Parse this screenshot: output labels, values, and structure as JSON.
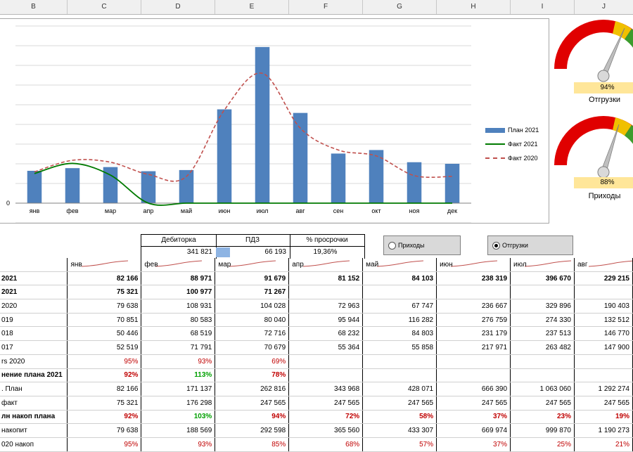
{
  "column_headers": [
    "B",
    "C",
    "D",
    "E",
    "F",
    "G",
    "H",
    "I",
    "J"
  ],
  "chart_data": {
    "type": "bar",
    "categories": [
      "янв",
      "фев",
      "мар",
      "апр",
      "май",
      "июн",
      "июл",
      "авг",
      "сен",
      "окт",
      "ноя",
      "дек"
    ],
    "y_tick_labels": [
      "",
      "",
      "",
      "",
      "",
      "",
      "",
      "",
      "",
      "0",
      ""
    ],
    "series": [
      {
        "name": "План 2021",
        "type": "bar",
        "color": "#4f81bd",
        "values": [
          82166,
          88971,
          91679,
          81152,
          84103,
          238319,
          396670,
          229215,
          126000,
          135000,
          104000,
          100000
        ]
      },
      {
        "name": "Факт 2021",
        "type": "line",
        "color": "#007a00",
        "values": [
          75321,
          100977,
          71267,
          0,
          0,
          0,
          0,
          0,
          0,
          0,
          0,
          0
        ]
      },
      {
        "name": "Факт 2020",
        "type": "line-dashed",
        "color": "#c0504d",
        "values": [
          79638,
          108931,
          104028,
          72963,
          67747,
          236667,
          329896,
          190403,
          135000,
          120000,
          70000,
          68000
        ]
      }
    ],
    "ylim": [
      -50000,
      450000
    ]
  },
  "gauges": [
    {
      "pct": "94%",
      "label": "Отгрузки",
      "value": 0.94
    },
    {
      "pct": "88%",
      "label": "Приходы",
      "value": 0.88
    }
  ],
  "stats": {
    "debitorka_label": "Дебиторка",
    "debitorka_value": "341 821",
    "pdz_label": "ПДЗ",
    "pdz_value": "66 193",
    "overdue_label": "% просрочки",
    "overdue_value": "19,36%"
  },
  "radios": {
    "incoming": "Приходы",
    "shipments": "Отгрузки"
  },
  "table": {
    "months": [
      "янв",
      "фев",
      "мар",
      "апр",
      "май",
      "июн",
      "июл",
      "авг"
    ],
    "rows": [
      {
        "label": "2021",
        "bold": true,
        "cells": [
          "82 166",
          "88 971",
          "91 679",
          "81 152",
          "84 103",
          "238 319",
          "396 670",
          "229 215"
        ]
      },
      {
        "label": "2021",
        "bold": true,
        "cells": [
          "75 321",
          "100 977",
          "71 267",
          "",
          "",
          "",
          "",
          ""
        ]
      },
      {
        "label": "2020",
        "cells": [
          "79 638",
          "108 931",
          "104 028",
          "72 963",
          "67 747",
          "236 667",
          "329 896",
          "190 403"
        ]
      },
      {
        "label": "019",
        "cells": [
          "70 851",
          "80 583",
          "80 040",
          "95 944",
          "116 282",
          "276 759",
          "274 330",
          "132 512"
        ]
      },
      {
        "label": "018",
        "cells": [
          "50 446",
          "68 519",
          "72 716",
          "68 232",
          "84 803",
          "231 179",
          "237 513",
          "146 770"
        ]
      },
      {
        "label": "017",
        "cells": [
          "52 519",
          "71 791",
          "70 679",
          "55 364",
          "55 858",
          "217 971",
          "263 482",
          "147 900"
        ]
      },
      {
        "label": "rs 2020",
        "cls": "red",
        "cells": [
          "95%",
          "93%",
          "69%",
          "",
          "",
          "",
          "",
          ""
        ]
      },
      {
        "label": "нение плана 2021",
        "bold": true,
        "cells": [
          "92%",
          "113%",
          "78%",
          "",
          "",
          "",
          "",
          ""
        ],
        "cellcls": [
          "red",
          "green",
          "red",
          "",
          "",
          "",
          "",
          ""
        ]
      },
      {
        "label": ". План",
        "cells": [
          "82 166",
          "171 137",
          "262 816",
          "343 968",
          "428 071",
          "666 390",
          "1 063 060",
          "1 292 274"
        ]
      },
      {
        "label": "факт",
        "cells": [
          "75 321",
          "176 298",
          "247 565",
          "247 565",
          "247 565",
          "247 565",
          "247 565",
          "247 565"
        ]
      },
      {
        "label": "лн накоп плана",
        "bold": true,
        "cells": [
          "92%",
          "103%",
          "94%",
          "72%",
          "58%",
          "37%",
          "23%",
          "19%"
        ],
        "cellcls": [
          "red",
          "green",
          "red",
          "red",
          "red",
          "red",
          "red",
          "red"
        ]
      },
      {
        "label": "накопит",
        "cells": [
          "79 638",
          "188 569",
          "292 598",
          "365 560",
          "433 307",
          "669 974",
          "999 870",
          "1 190 273"
        ]
      },
      {
        "label": "020 накоп",
        "cls": "red",
        "cells": [
          "95%",
          "93%",
          "85%",
          "68%",
          "57%",
          "37%",
          "25%",
          "21%"
        ]
      }
    ]
  }
}
